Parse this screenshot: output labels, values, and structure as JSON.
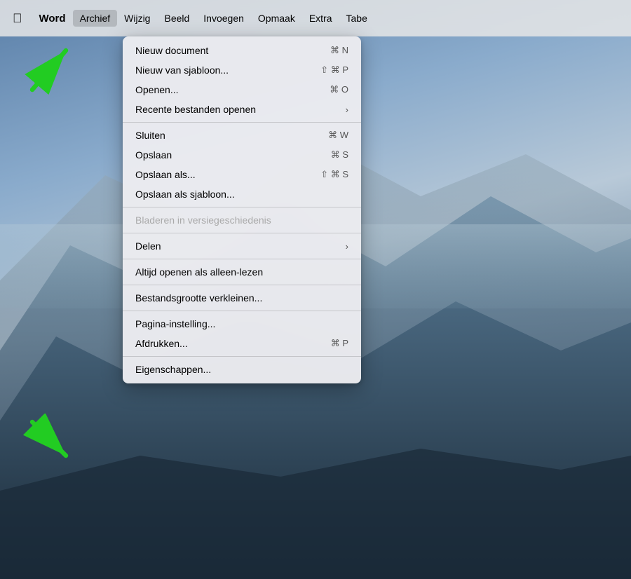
{
  "desktop": {
    "background": "macOS Big Sur mountain scene"
  },
  "menubar": {
    "apple_label": "",
    "items": [
      {
        "id": "apple",
        "label": ""
      },
      {
        "id": "word",
        "label": "Word"
      },
      {
        "id": "archief",
        "label": "Archief",
        "active": true
      },
      {
        "id": "wijzig",
        "label": "Wijzig"
      },
      {
        "id": "beeld",
        "label": "Beeld"
      },
      {
        "id": "invoegen",
        "label": "Invoegen"
      },
      {
        "id": "opmaak",
        "label": "Opmaak"
      },
      {
        "id": "extra",
        "label": "Extra"
      },
      {
        "id": "tabe",
        "label": "Tabe"
      }
    ]
  },
  "dropdown": {
    "items": [
      {
        "id": "nieuw-document",
        "label": "Nieuw document",
        "shortcut": "⌘ N",
        "type": "item",
        "arrow": false
      },
      {
        "id": "nieuw-sjabloon",
        "label": "Nieuw van sjabloon...",
        "shortcut": "⇧ ⌘ P",
        "type": "item",
        "arrow": false
      },
      {
        "id": "openen",
        "label": "Openen...",
        "shortcut": "⌘ O",
        "type": "item",
        "arrow": false
      },
      {
        "id": "recente-bestanden",
        "label": "Recente bestanden openen",
        "shortcut": "",
        "type": "item",
        "arrow": true
      },
      {
        "id": "sep1",
        "type": "separator"
      },
      {
        "id": "sluiten",
        "label": "Sluiten",
        "shortcut": "⌘ W",
        "type": "item",
        "arrow": false
      },
      {
        "id": "opslaan",
        "label": "Opslaan",
        "shortcut": "⌘ S",
        "type": "item",
        "arrow": false
      },
      {
        "id": "opslaan-als",
        "label": "Opslaan als...",
        "shortcut": "⇧ ⌘ S",
        "type": "item",
        "arrow": false
      },
      {
        "id": "opslaan-sjabloon",
        "label": "Opslaan als sjabloon...",
        "shortcut": "",
        "type": "item",
        "arrow": false
      },
      {
        "id": "sep2",
        "type": "separator"
      },
      {
        "id": "bladeren",
        "label": "Bladeren in versiegeschiedenis",
        "shortcut": "",
        "type": "disabled",
        "arrow": false
      },
      {
        "id": "sep3",
        "type": "separator"
      },
      {
        "id": "delen",
        "label": "Delen",
        "shortcut": "",
        "type": "item",
        "arrow": true
      },
      {
        "id": "sep4",
        "type": "separator"
      },
      {
        "id": "altijd-openen",
        "label": "Altijd openen als alleen-lezen",
        "shortcut": "",
        "type": "item",
        "arrow": false
      },
      {
        "id": "sep5",
        "type": "separator"
      },
      {
        "id": "bestandsgrootte",
        "label": "Bestandsgrootte verkleinen...",
        "shortcut": "",
        "type": "item",
        "arrow": false
      },
      {
        "id": "sep6",
        "type": "separator"
      },
      {
        "id": "pagina-instelling",
        "label": "Pagina-instelling...",
        "shortcut": "",
        "type": "item",
        "arrow": false
      },
      {
        "id": "afdrukken",
        "label": "Afdrukken...",
        "shortcut": "⌘ P",
        "type": "item",
        "arrow": false
      },
      {
        "id": "sep7",
        "type": "separator"
      },
      {
        "id": "eigenschappen",
        "label": "Eigenschappen...",
        "shortcut": "",
        "type": "item",
        "arrow": false
      }
    ]
  },
  "arrows": {
    "top": {
      "direction": "upper-right",
      "color": "#2ecc40"
    },
    "bottom": {
      "direction": "lower-right",
      "color": "#2ecc40"
    }
  }
}
